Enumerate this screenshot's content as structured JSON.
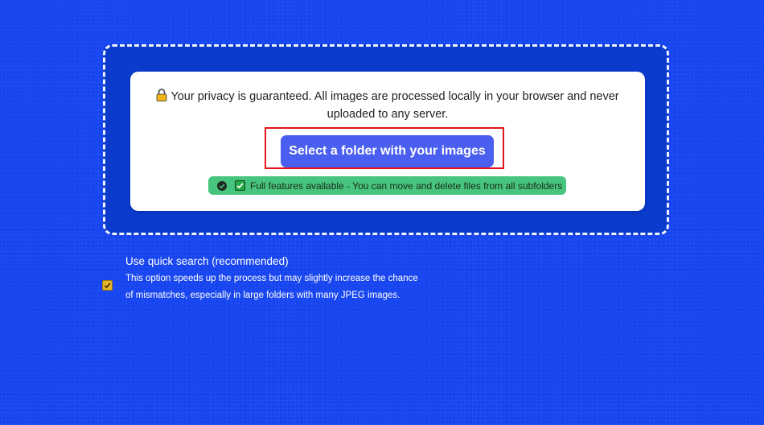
{
  "upload": {
    "privacy_text": "Your privacy is guaranteed. All images are processed locally in your browser and never uploaded to any server.",
    "select_button_label": "Select a folder with your images",
    "features_text": "Full features available - You can move and delete files from all subfolders"
  },
  "options": {
    "quick_search": {
      "checked": true,
      "title": "Use quick search (recommended)",
      "description": "This option speeds up the process but may slightly increase the chance of mismatches, especially in large folders with many JPEG images."
    }
  },
  "icons": {
    "privacy": "lock-icon",
    "features_status": "check-circle-icon",
    "features_check": "check-box-icon"
  },
  "colors": {
    "background": "#1846f0",
    "drop_zone": "#0a3bcc",
    "button": "#4a5ff0",
    "badge": "#47c47e",
    "highlight": "#e3141b",
    "checkbox": "#e4b42a"
  }
}
